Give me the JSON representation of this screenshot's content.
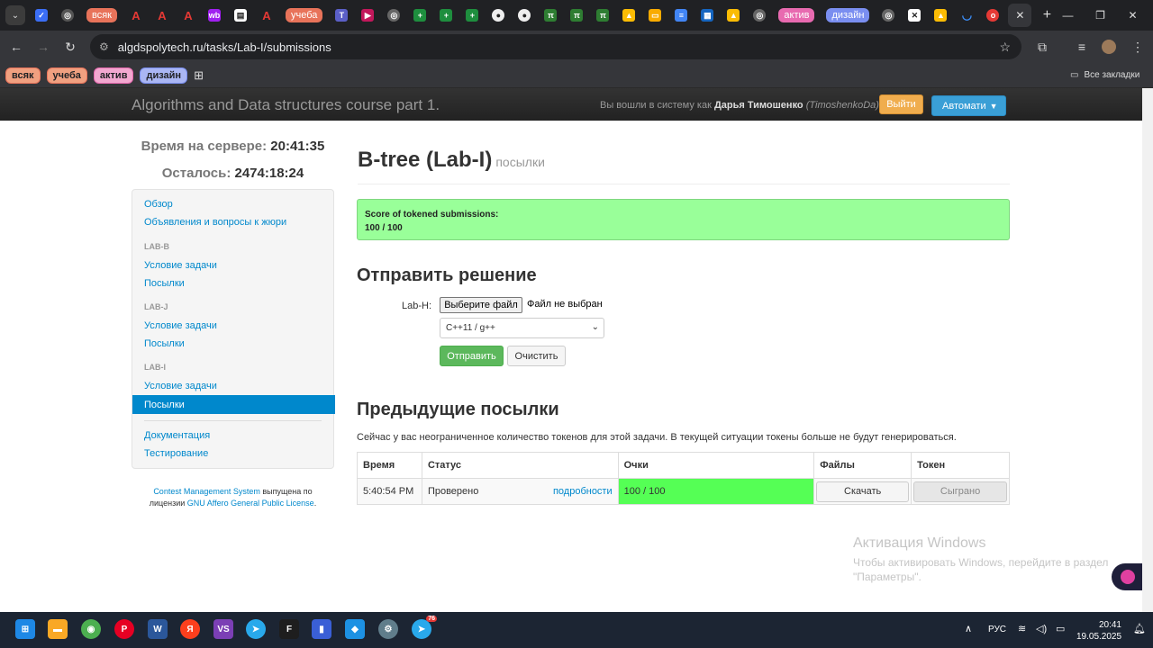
{
  "browser": {
    "tab_groups": {
      "vsyak": "всяк",
      "ucheba": "учеба",
      "aktiv": "актив",
      "dizain": "дизайн"
    },
    "url": "algdspolytech.ru/tasks/Lab-I/submissions",
    "bookmarks": [
      "всяк",
      "учеба",
      "актив",
      "дизайн"
    ],
    "all_bookmarks": "Все закладки"
  },
  "header": {
    "course_title": "Algorithms and Data structures course part 1.",
    "login_prefix": "Вы вошли в систему как",
    "user_name": "Дарья Тимошенко",
    "user_login": "(TimoshenkoDa)",
    "logout": "Выйти",
    "lang_button": "Автомати"
  },
  "timer": {
    "server_label": "Время на сервере:",
    "server_time": "20:41:35",
    "remaining_label": "Осталось:",
    "remaining": "2474:18:24"
  },
  "sidebar": {
    "overview": "Обзор",
    "announcements": "Объявления и вопросы к жюри",
    "lab_b": "LAB-B",
    "lab_b_statement": "Условие задачи",
    "lab_b_submissions": "Посылки",
    "lab_j": "LAB-J",
    "lab_j_statement": "Условие задачи",
    "lab_j_submissions": "Посылки",
    "lab_i": "LAB-I",
    "lab_i_statement": "Условие задачи",
    "lab_i_submissions": "Посылки",
    "documentation": "Документация",
    "testing": "Тестирование"
  },
  "footer": {
    "cms": "Contest Management System",
    "released": " выпущена по",
    "license_prefix": "лицензии ",
    "license": "GNU Affero General Public License",
    "dot": "."
  },
  "task": {
    "title": "B-tree (Lab-I)",
    "subtitle": "посылки",
    "score_label": "Score of tokened submissions:",
    "score_value": "100 / 100"
  },
  "submit": {
    "heading": "Отправить решение",
    "file_label": "Lab-H:",
    "choose_file": "Выберите файл",
    "no_file": "Файл не выбран",
    "language": "C++11 / g++",
    "send": "Отправить",
    "clear": "Очистить"
  },
  "previous": {
    "heading": "Предыдущие посылки",
    "token_note": "Сейчас у вас неограниченное количество токенов для этой задачи. В текущей ситуации токены больше не будут генерироваться.",
    "columns": [
      "Время",
      "Статус",
      "Очки",
      "Файлы",
      "Токен"
    ],
    "rows": [
      {
        "time": "5:40:54 PM",
        "status": "Проверено",
        "details": "подробности",
        "score": "100 / 100",
        "download": "Скачать",
        "token": "Сыграно"
      }
    ]
  },
  "watermark": {
    "title": "Активация Windows",
    "line1": "Чтобы активировать Windows, перейдите в раздел",
    "line2": "\"Параметры\"."
  },
  "taskbar": {
    "lang": "РУС",
    "time": "20:41",
    "date": "19.05.2025",
    "telegram_badge": "76"
  },
  "colors": {
    "link": "#0088cc",
    "score_bg": "#99ff99",
    "score_cell": "#55ff55",
    "send": "#5cb85c",
    "logout": "#f0ad4e"
  }
}
